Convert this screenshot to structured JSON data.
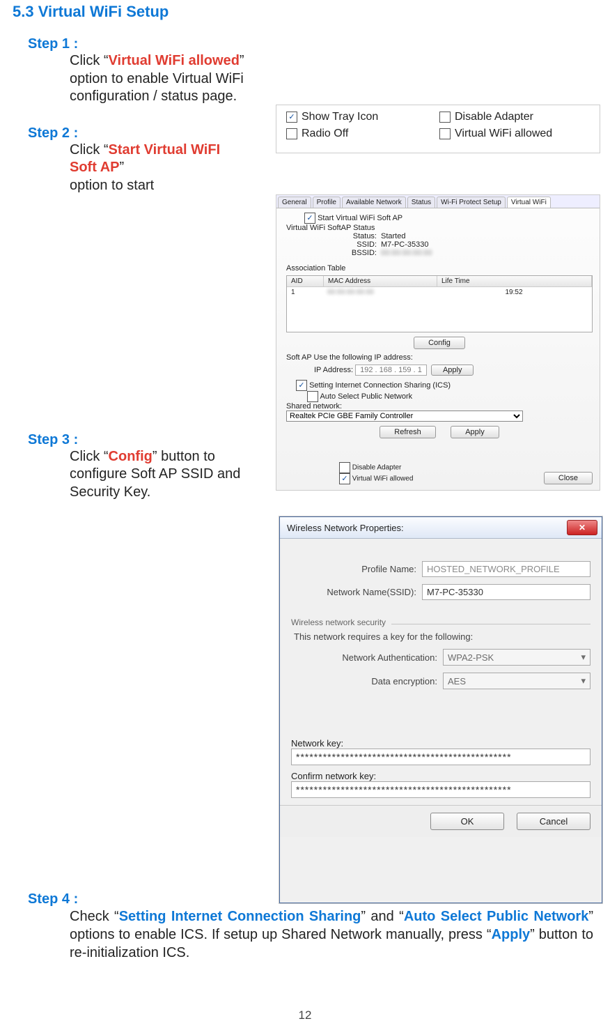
{
  "section_title": "5.3 Virtual WiFi Setup",
  "page_number": "12",
  "step1": {
    "heading": "Step 1 :",
    "t1": "Click “",
    "hl": "Virtual WiFi allowed",
    "t2": "” option to enable Virtual WiFi configuration / status page."
  },
  "step2": {
    "heading": "Step 2 :",
    "t1": "Click “",
    "hl": "Start Virtual WiFI Soft AP",
    "t2": "”",
    "t3": "option to start"
  },
  "step3": {
    "heading": "Step 3 :",
    "t1": "Click “",
    "hl": "Config",
    "t2": "” button to configure Soft AP SSID and Security Key."
  },
  "step4": {
    "heading": "Step 4 :",
    "t1": "Check “",
    "hl1": "Setting Internet Connection Sharing",
    "t2": "” and “",
    "hl2": "Auto Select Public Network",
    "t3": "” options to enable ICS. If setup up Shared Network manually, press “",
    "hl3": "Apply",
    "t4": "” button to re-initialization ICS."
  },
  "fig1": {
    "show_tray_icon": "Show Tray Icon",
    "radio_off": "Radio Off",
    "disable_adapter": "Disable Adapter",
    "virtual_wifi_allowed": "Virtual WiFi allowed"
  },
  "fig2": {
    "tabs": {
      "general": "General",
      "profile": "Profile",
      "available": "Available Network",
      "status": "Status",
      "wps": "Wi-Fi Protect Setup",
      "vwifi": "Virtual WiFi"
    },
    "start_label": "Start Virtual WiFi Soft AP",
    "status_header": "Virtual WiFi SoftAP Status",
    "status_label": "Status:",
    "status_value": "Started",
    "ssid_label": "SSID:",
    "ssid_value": "M7-PC-35330",
    "bssid_label": "BSSID:",
    "assoc_header": "Association Table",
    "col_aid": "AID",
    "col_mac": "MAC Address",
    "col_life": "Life Time",
    "row_aid": "1",
    "row_life": "19:52",
    "config_btn": "Config",
    "ip_note": "Soft AP Use the following IP address:",
    "ip_label": "IP Address:",
    "ip_value": "192 . 168 . 159 .  1",
    "apply_btn": "Apply",
    "ics_label": "Setting Internet Connection Sharing (ICS)",
    "auto_label": "Auto Select Public Network",
    "shared_label": "Shared network:",
    "shared_value": "Realtek PCIe GBE Family Controller",
    "refresh_btn": "Refresh",
    "apply_btn2": "Apply",
    "disable_adapter": "Disable Adapter",
    "vwifi_allowed": "Virtual WiFi allowed",
    "close_btn": "Close"
  },
  "fig3": {
    "title": "Wireless Network Properties:",
    "profile_name_label": "Profile Name:",
    "profile_name_value": "HOSTED_NETWORK_PROFILE",
    "ssid_label": "Network Name(SSID):",
    "ssid_value": "M7-PC-35330",
    "sec_group": "Wireless network security",
    "sec_note": "This network requires a key for the following:",
    "auth_label": "Network Authentication:",
    "auth_value": "WPA2-PSK",
    "enc_label": "Data encryption:",
    "enc_value": "AES",
    "key_label": "Network key:",
    "key_value": "************************************************",
    "confirm_label": "Confirm network key:",
    "confirm_value": "************************************************",
    "ok_btn": "OK",
    "cancel_btn": "Cancel"
  }
}
